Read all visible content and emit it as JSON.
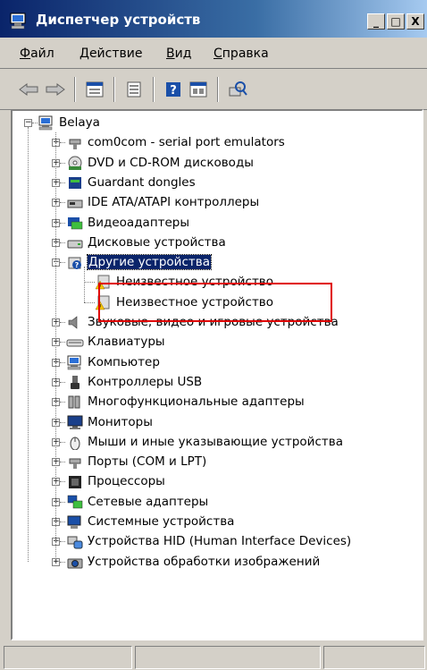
{
  "window": {
    "title": "Диспетчер устройств",
    "controls": [
      "_",
      "□",
      "X"
    ]
  },
  "menu": [
    {
      "label": "Файл",
      "accel": "Ф",
      "rest": "айл"
    },
    {
      "label": "Действие",
      "accel": "Д",
      "rest": "ействие"
    },
    {
      "label": "Вид",
      "accel": "В",
      "rest": "ид"
    },
    {
      "label": "Справка",
      "accel": "С",
      "rest": "правка"
    }
  ],
  "toolbar": [
    "back-icon",
    "forward-icon",
    "up-icon",
    "properties-icon",
    "help-icon",
    "console-icon",
    "scan-hardware-icon"
  ],
  "tree": {
    "root": {
      "label": "Belaya",
      "icon": "computer-icon"
    },
    "items": [
      {
        "label": "com0com - serial port emulators",
        "icon": "port-icon"
      },
      {
        "label": "DVD и CD-ROM дисководы",
        "icon": "dvd-icon"
      },
      {
        "label": "Guardant dongles",
        "icon": "dongle-icon"
      },
      {
        "label": "IDE ATA/ATAPI контроллеры",
        "icon": "ide-icon"
      },
      {
        "label": "Видеоадаптеры",
        "icon": "display-adapter-icon"
      },
      {
        "label": "Дисковые устройства",
        "icon": "disk-icon"
      },
      {
        "label": "Другие устройства",
        "icon": "unknown-device-icon",
        "expanded": true,
        "selected": true,
        "children": [
          {
            "label": "Неизвестное устройство",
            "icon": "warning-device-icon"
          },
          {
            "label": "Неизвестное устройство",
            "icon": "warning-device-icon"
          }
        ]
      },
      {
        "label": "Звуковые, видео и игровые устройства",
        "icon": "sound-icon"
      },
      {
        "label": "Клавиатуры",
        "icon": "keyboard-icon"
      },
      {
        "label": "Компьютер",
        "icon": "computer-icon"
      },
      {
        "label": "Контроллеры USB",
        "icon": "usb-icon"
      },
      {
        "label": "Многофункциональные адаптеры",
        "icon": "multifunction-icon"
      },
      {
        "label": "Мониторы",
        "icon": "monitor-icon"
      },
      {
        "label": "Мыши и иные указывающие устройства",
        "icon": "mouse-icon"
      },
      {
        "label": "Порты (COM и LPT)",
        "icon": "port-icon"
      },
      {
        "label": "Процессоры",
        "icon": "cpu-icon"
      },
      {
        "label": "Сетевые адаптеры",
        "icon": "network-icon"
      },
      {
        "label": "Системные устройства",
        "icon": "system-icon"
      },
      {
        "label": "Устройства HID (Human Interface Devices)",
        "icon": "hid-icon"
      },
      {
        "label": "Устройства обработки изображений",
        "icon": "imaging-icon"
      }
    ]
  },
  "highlight_color": "#e00000",
  "selection_color": "#0a246a"
}
